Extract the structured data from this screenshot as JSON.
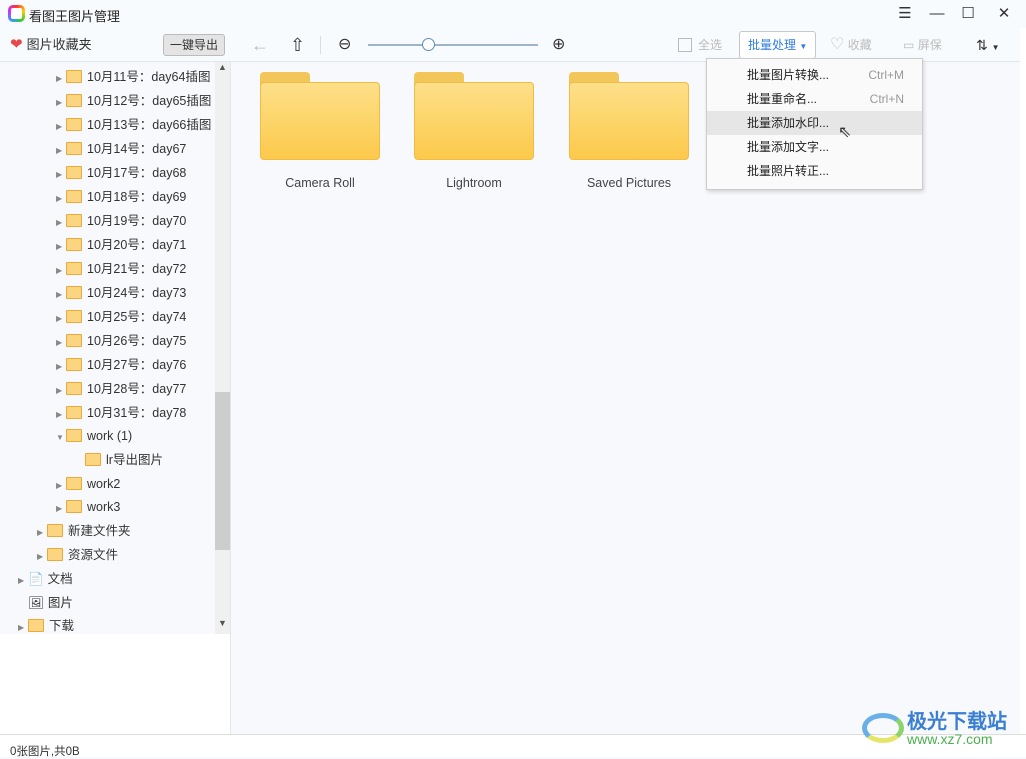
{
  "window": {
    "title": "看图王图片管理",
    "icon": "app-logo-icon"
  },
  "toolbar": {
    "favorites": "图片收藏夹",
    "export": "一键导出",
    "select_all": "全选",
    "batch": "批量处理",
    "collect": "收藏",
    "screensaver": "屏保"
  },
  "tree": [
    {
      "label": "10月11号：day64插图",
      "level": 3,
      "expander": true
    },
    {
      "label": "10月12号：day65插图",
      "level": 3,
      "expander": true
    },
    {
      "label": "10月13号：day66插图",
      "level": 3,
      "expander": true
    },
    {
      "label": "10月14号：day67",
      "level": 3,
      "expander": true
    },
    {
      "label": "10月17号：day68",
      "level": 3,
      "expander": true
    },
    {
      "label": "10月18号：day69",
      "level": 3,
      "expander": true
    },
    {
      "label": "10月19号：day70",
      "level": 3,
      "expander": true
    },
    {
      "label": "10月20号：day71",
      "level": 3,
      "expander": true
    },
    {
      "label": "10月21号：day72",
      "level": 3,
      "expander": true
    },
    {
      "label": "10月24号：day73",
      "level": 3,
      "expander": true
    },
    {
      "label": "10月25号：day74",
      "level": 3,
      "expander": true
    },
    {
      "label": "10月26号：day75",
      "level": 3,
      "expander": true
    },
    {
      "label": "10月27号：day76",
      "level": 3,
      "expander": true
    },
    {
      "label": "10月28号：day77",
      "level": 3,
      "expander": true
    },
    {
      "label": "10月31号：day78",
      "level": 3,
      "expander": true
    },
    {
      "label": "work (1)",
      "level": 3,
      "expander": "open"
    },
    {
      "label": "lr导出图片",
      "level": 4,
      "expander": false
    },
    {
      "label": "work2",
      "level": 3,
      "expander": true
    },
    {
      "label": "work3",
      "level": 3,
      "expander": true
    },
    {
      "label": "新建文件夹",
      "level": 2,
      "expander": true
    },
    {
      "label": "资源文件",
      "level": 2,
      "expander": true
    },
    {
      "label": "文档",
      "level": 1,
      "expander": true,
      "icon": "document-icon"
    },
    {
      "label": "图片",
      "level": 1,
      "expander": false,
      "icon": "picture-icon"
    },
    {
      "label": "下载",
      "level": 1,
      "expander": true
    }
  ],
  "folders": [
    "Camera Roll",
    "Lightroom",
    "Saved Pictures"
  ],
  "menu": [
    {
      "label": "批量图片转换...",
      "shortcut": "Ctrl+M"
    },
    {
      "label": "批量重命名...",
      "shortcut": "Ctrl+N"
    },
    {
      "label": "批量添加水印...",
      "shortcut": "",
      "highlighted": true
    },
    {
      "label": "批量添加文字...",
      "shortcut": ""
    },
    {
      "label": "批量照片转正...",
      "shortcut": ""
    }
  ],
  "status": "0张图片,共0B",
  "zoom_level": 0.35,
  "watermark": {
    "name": "极光下载站",
    "url": "www.xz7.com"
  },
  "colors": {
    "accent": "#2f7de1",
    "heart": "#e5484d",
    "folder": "#fcc94a"
  }
}
